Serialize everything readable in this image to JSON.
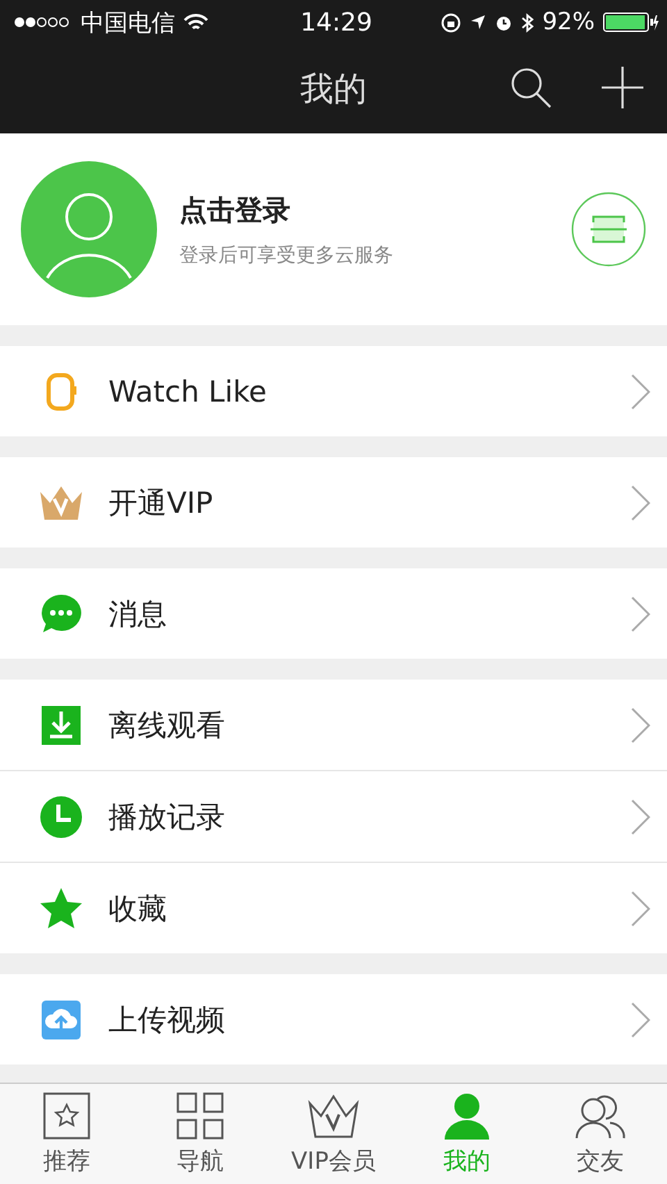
{
  "status_bar": {
    "carrier": "中国电信",
    "time": "14:29",
    "battery": "92%"
  },
  "header": {
    "title": "我的"
  },
  "profile": {
    "name": "点击登录",
    "subtitle": "登录后可享受更多云服务"
  },
  "menu_groups": [
    [
      {
        "label": "Watch Like",
        "kind": "watch"
      }
    ],
    [
      {
        "label": "开通VIP",
        "kind": "crown"
      }
    ],
    [
      {
        "label": "消息",
        "kind": "chat"
      }
    ],
    [
      {
        "label": "离线观看",
        "kind": "download"
      },
      {
        "label": "播放记录",
        "kind": "clock"
      },
      {
        "label": "收藏",
        "kind": "star"
      }
    ],
    [
      {
        "label": "上传视频",
        "kind": "upload"
      }
    ]
  ],
  "tab_bar": [
    {
      "label": "推荐",
      "kind": "recommend",
      "selected": false
    },
    {
      "label": "导航",
      "kind": "grid",
      "selected": false
    },
    {
      "label": "VIP会员",
      "kind": "crown",
      "selected": false
    },
    {
      "label": "我的",
      "kind": "person",
      "selected": true
    },
    {
      "label": "交友",
      "kind": "people",
      "selected": false
    }
  ]
}
